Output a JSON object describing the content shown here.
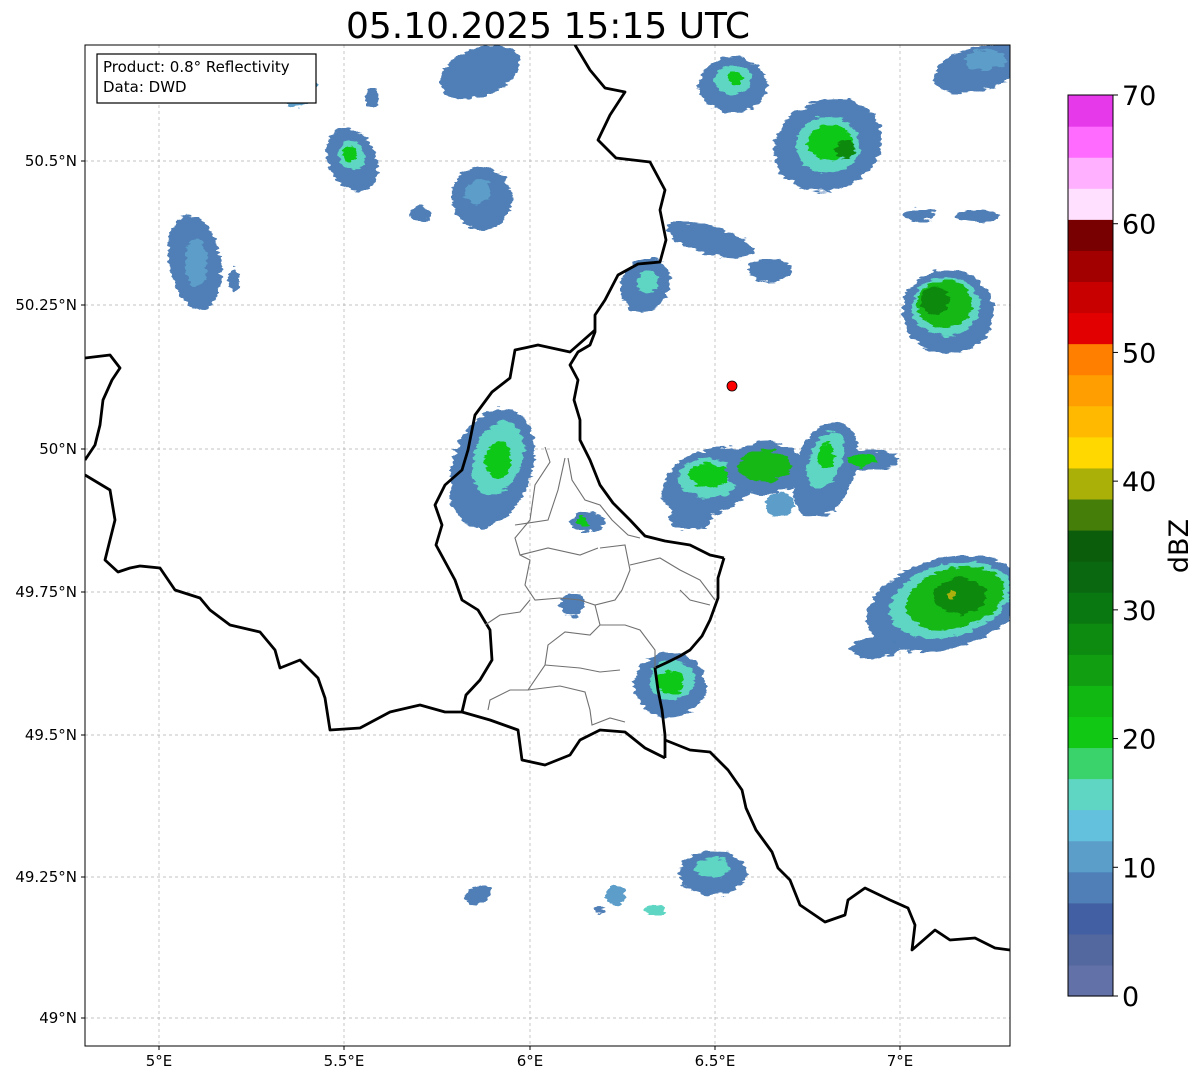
{
  "title": "05.10.2025 15:15 UTC",
  "info_box": {
    "product": "Product: 0.8° Reflectivity",
    "data": "Data: DWD"
  },
  "axes": {
    "x_ticks": [
      "5°E",
      "5.5°E",
      "6°E",
      "6.5°E",
      "7°E"
    ],
    "y_ticks": [
      "50.5°N",
      "50.25°N",
      "50°N",
      "49.75°N",
      "49.5°N",
      "49.25°N",
      "49°N"
    ]
  },
  "colorbar": {
    "label": "dBZ",
    "ticks": [
      "0",
      "10",
      "20",
      "30",
      "40",
      "50",
      "60",
      "70"
    ],
    "colors": [
      "#6272a8",
      "#52689e",
      "#435fa4",
      "#4f7fb6",
      "#5b9ec9",
      "#64c1de",
      "#5fd6c4",
      "#3ad36b",
      "#11c814",
      "#12b812",
      "#119e11",
      "#0d8a10",
      "#0a7810",
      "#0a6810",
      "#0b5c0b",
      "#467e0a",
      "#abb009",
      "#ffd800",
      "#ffba00",
      "#ff9e00",
      "#ff8000",
      "#e30000",
      "#c80000",
      "#a20000",
      "#780000",
      "#ffe0ff",
      "#ffb1ff",
      "#ff6bff",
      "#e639ea"
    ]
  },
  "radar_site": {
    "lon": 6.55,
    "lat": 50.11,
    "color": "#ff0000"
  },
  "chart_data": {
    "type": "heatmap",
    "title": "05.10.2025 15:15 UTC",
    "xlabel": "",
    "ylabel": "",
    "xlim": [
      4.8,
      7.3
    ],
    "ylim": [
      48.95,
      50.7
    ],
    "x_ticks": [
      5.0,
      5.5,
      6.0,
      6.5,
      7.0
    ],
    "y_ticks": [
      49.0,
      49.25,
      49.5,
      49.75,
      50.0,
      50.25,
      50.5
    ],
    "grid": true,
    "colorbar_label": "dBZ",
    "colorbar_range": [
      0,
      70
    ],
    "echoes": [
      {
        "lon": 5.9,
        "lat": 50.35,
        "dbz": 12
      },
      {
        "lon": 5.5,
        "lat": 50.5,
        "dbz": 18
      },
      {
        "lon": 5.1,
        "lat": 50.3,
        "dbz": 10
      },
      {
        "lon": 6.58,
        "lat": 50.63,
        "dbz": 15
      },
      {
        "lon": 6.85,
        "lat": 50.53,
        "dbz": 25
      },
      {
        "lon": 7.08,
        "lat": 50.27,
        "dbz": 32
      },
      {
        "lon": 6.3,
        "lat": 50.3,
        "dbz": 15
      },
      {
        "lon": 6.75,
        "lat": 49.97,
        "dbz": 26
      },
      {
        "lon": 5.95,
        "lat": 49.95,
        "dbz": 20
      },
      {
        "lon": 7.1,
        "lat": 49.73,
        "dbz": 33
      },
      {
        "lon": 6.38,
        "lat": 49.57,
        "dbz": 24
      },
      {
        "lon": 6.5,
        "lat": 49.27,
        "dbz": 14
      },
      {
        "lon": 5.85,
        "lat": 49.21,
        "dbz": 14
      }
    ]
  }
}
